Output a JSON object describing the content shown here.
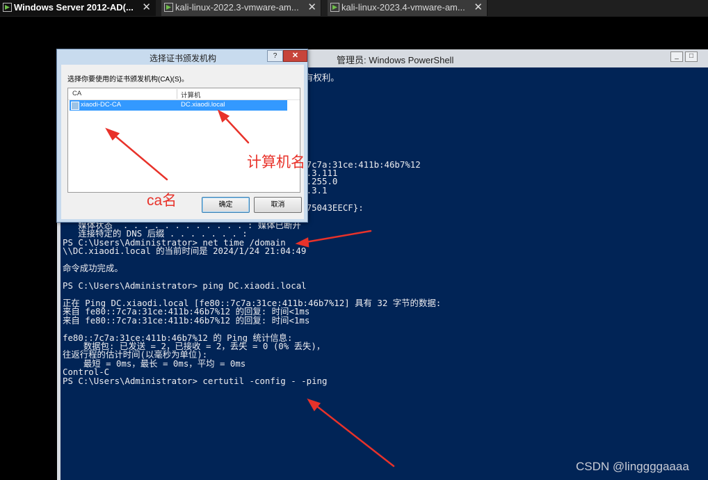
{
  "tabs": [
    {
      "label": "Windows Server 2012-AD(...",
      "close": "✕",
      "active": true
    },
    {
      "label": "kali-linux-2022.3-vmware-am...",
      "close": "✕",
      "active": false
    },
    {
      "label": "kali-linux-2023.4-vmware-am...",
      "close": "✕",
      "active": false
    }
  ],
  "powershell": {
    "title": "管理员: Windows PowerShell",
    "minimize": "_",
    "maximize": "□",
    "lines": [
      "                                             所有权利。",
      "",
      "",
      "",
      "",
      "",
      "",
      "",
      "",
      "",
      "                                               7c7a:31ce:411b:46b7%12",
      "                                               .3.111",
      "                                               .255.0",
      "                                               .3.1",
      "",
      "                                               75043EECF}:",
      "",
      "   媒体状态  . . . . . . . . . . . . : 媒体已断开",
      "   连接特定的 DNS 后缀 . . . . . . . :",
      "PS C:\\Users\\Administrator> net time /domain",
      "\\\\DC.xiaodi.local 的当前时间是 2024/1/24 21:04:49",
      "",
      "命令成功完成。",
      "",
      "PS C:\\Users\\Administrator> ping DC.xiaodi.local",
      "",
      "正在 Ping DC.xiaodi.local [fe80::7c7a:31ce:411b:46b7%12] 具有 32 字节的数据:",
      "来自 fe80::7c7a:31ce:411b:46b7%12 的回复: 时间<1ms",
      "来自 fe80::7c7a:31ce:411b:46b7%12 的回复: 时间<1ms",
      "",
      "fe80::7c7a:31ce:411b:46b7%12 的 Ping 统计信息:",
      "    数据包: 已发送 = 2，已接收 = 2，丢失 = 0 (0% 丢失)，",
      "往返行程的估计时间(以毫秒为单位):",
      "    最短 = 0ms，最长 = 0ms，平均 = 0ms",
      "Control-C",
      "PS C:\\Users\\Administrator> certutil -config - -ping"
    ]
  },
  "dialog": {
    "title": "选择证书颁发机构",
    "help": "?",
    "close": "✕",
    "prompt": "选择你要使用的证书颁发机构(CA)(S)。",
    "columns": [
      "CA",
      "计算机"
    ],
    "rows": [
      {
        "ca": "xiaodi-DC-CA",
        "computer": "DC.xiaodi.local"
      }
    ],
    "ok_label": "确定",
    "cancel_label": "取消"
  },
  "annotations": {
    "computer_name": "计算机名",
    "ca_name": "ca名"
  },
  "watermark": "CSDN @linggggaaaa",
  "colors": {
    "ps_background": "#012456",
    "annotation_red": "#e8322a",
    "selection_blue": "#3399ff",
    "close_red": "#c7443a"
  }
}
